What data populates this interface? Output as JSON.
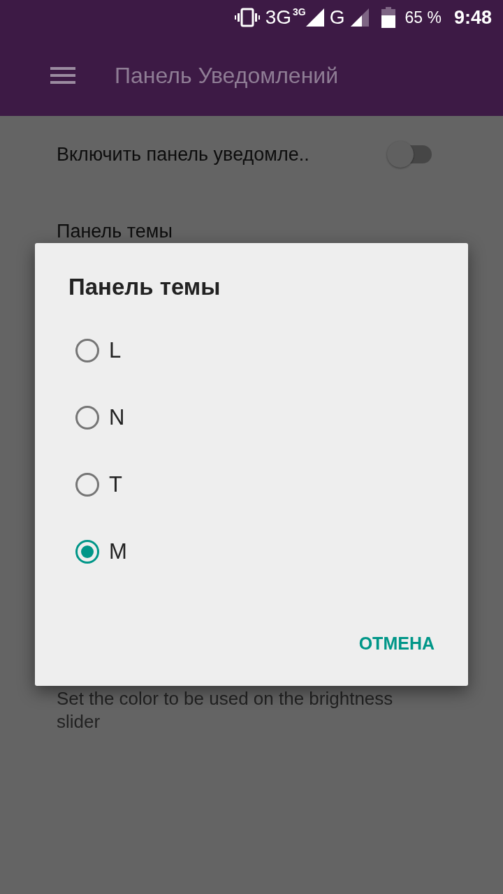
{
  "status_bar": {
    "network": "3G",
    "network_small": "3G",
    "network2": "G",
    "battery": "65 %",
    "time": "9:48"
  },
  "app_bar": {
    "title": "Панель Уведомлений"
  },
  "settings": [
    {
      "kind": "switch",
      "title": "Включить панель уведомле..",
      "on": false
    },
    {
      "kind": "text",
      "title": "Панель темы"
    },
    {
      "kind": "description",
      "summary": "Set the color to be used on the brightness slider"
    }
  ],
  "dialog": {
    "title": "Панель темы",
    "options": [
      {
        "label": "L",
        "selected": false
      },
      {
        "label": "N",
        "selected": false
      },
      {
        "label": "T",
        "selected": false
      },
      {
        "label": "M",
        "selected": true
      }
    ],
    "button": "ОТМЕНА"
  }
}
